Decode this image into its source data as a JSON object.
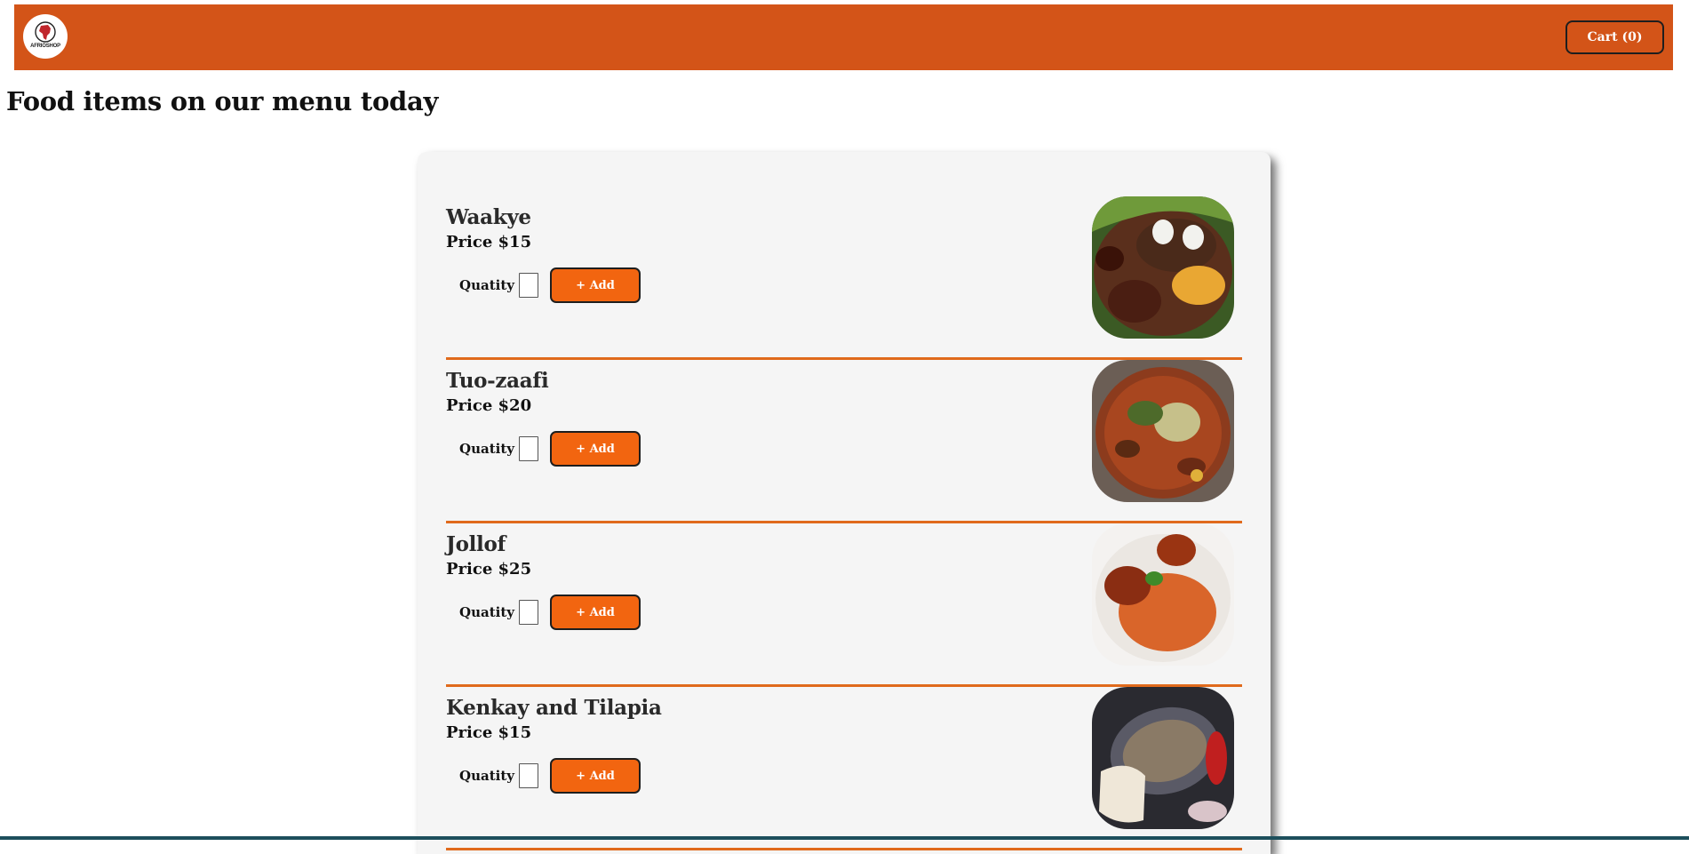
{
  "header": {
    "logo_text": "AFRIOSHOP",
    "cart_label": "Cart (0)"
  },
  "page_title": "Food items on our menu today",
  "qty_label": "Quatity",
  "add_label": "+ Add",
  "foods": [
    {
      "name": "Waakye",
      "price": "Price $15",
      "image": "waakye-dish-photo"
    },
    {
      "name": "Tuo-zaafi",
      "price": "Price $20",
      "image": "tuo-zaafi-dish-photo"
    },
    {
      "name": "Jollof",
      "price": "Price $25",
      "image": "jollof-dish-photo"
    },
    {
      "name": "Kenkay and Tilapia",
      "price": "Price $15",
      "image": "kenkey-tilapia-dish-photo"
    }
  ],
  "colors": {
    "navbar": "#d35418",
    "add_button": "#f26510",
    "divider": "#e06a1c",
    "card": "#f5f5f5"
  }
}
